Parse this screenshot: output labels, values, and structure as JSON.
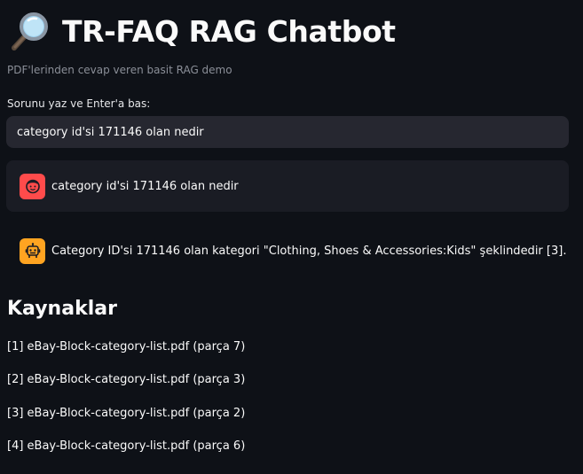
{
  "app": {
    "title": "TR-FAQ RAG Chatbot",
    "title_icon": "magnifying-glass-icon",
    "subtitle": "PDF'lerinden cevap veren basit RAG demo"
  },
  "input": {
    "label": "Sorunu yaz ve Enter'a bas:",
    "value": "category id'si 171146 olan nedir"
  },
  "chat": {
    "user_message": {
      "avatar_icon": "user-face-icon",
      "text": "category id'si 171146 olan nedir"
    },
    "assistant_message": {
      "avatar_icon": "robot-icon",
      "text": "Category ID'si 171146 olan kategori \"Clothing, Shoes & Accessories:Kids\" şeklindedir [3]."
    }
  },
  "sources": {
    "heading": "Kaynaklar",
    "items": [
      "[1] eBay-Block-category-list.pdf (parça 7)",
      "[2] eBay-Block-category-list.pdf (parça 3)",
      "[3] eBay-Block-category-list.pdf (parça 2)",
      "[4] eBay-Block-category-list.pdf (parça 6)"
    ]
  },
  "colors": {
    "background": "#0e1117",
    "input_bg": "#262730",
    "user_message_bg": "#1a1c24",
    "user_avatar": "#ff4b4b",
    "assistant_avatar": "#ffa421",
    "subtitle_text": "#8b8f98"
  }
}
